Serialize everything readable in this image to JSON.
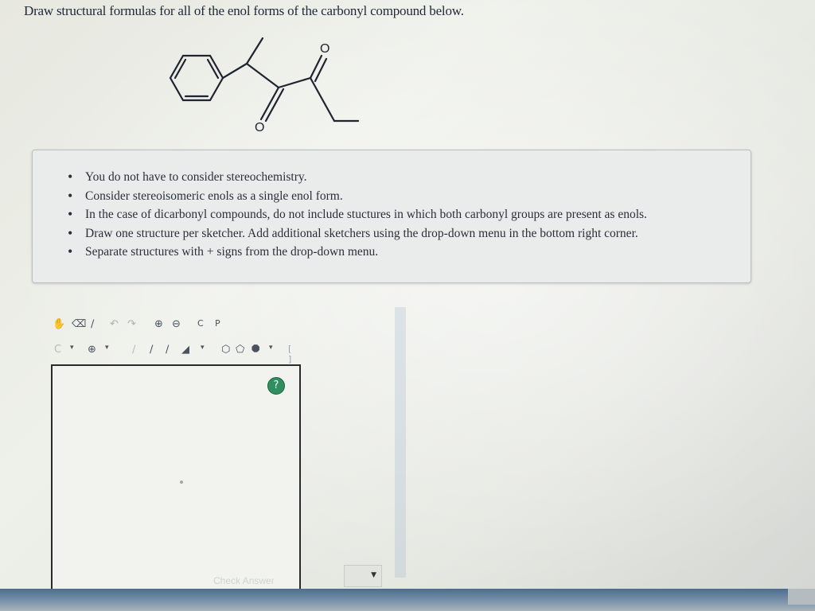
{
  "question": {
    "text": "Draw structural formulas for all of the enol forms of the carbonyl compound below."
  },
  "molecule": {
    "oxygen_label": "O"
  },
  "hints": [
    "You do not have to consider stereochemistry.",
    "Consider stereoisomeric enols as a single enol form.",
    "In the case of dicarbonyl compounds, do not include stuctures in which both carbonyl groups are present as enols.",
    "Draw one structure per sketcher. Add additional sketchers using the drop-down menu in the bottom right corner.",
    "Separate structures with + signs from the drop-down menu."
  ],
  "toolbar": {
    "row1": [
      "hand-icon",
      "erase-icon",
      "bond-icon",
      "undo-icon",
      "redo-icon",
      "zoom-in-icon",
      "zoom-out-icon",
      "template-c-icon",
      "template-p-icon"
    ],
    "row2": [
      "atom-c-icon",
      "charge-icon",
      "single-bond-icon",
      "double-bond-icon",
      "triple-bond-icon",
      "wedge-bond-icon",
      "ring-6-icon",
      "ring-5-icon",
      "ring-8-icon",
      "bracket-icon"
    ]
  },
  "sketcher": {
    "help_label": "?"
  },
  "footer": {
    "check_answer_label": "Check Answer",
    "dropdown_arrow": "▼"
  },
  "colors": {
    "help_button": "#2f8f5f",
    "bottom_bar": "#4d6d8e"
  }
}
